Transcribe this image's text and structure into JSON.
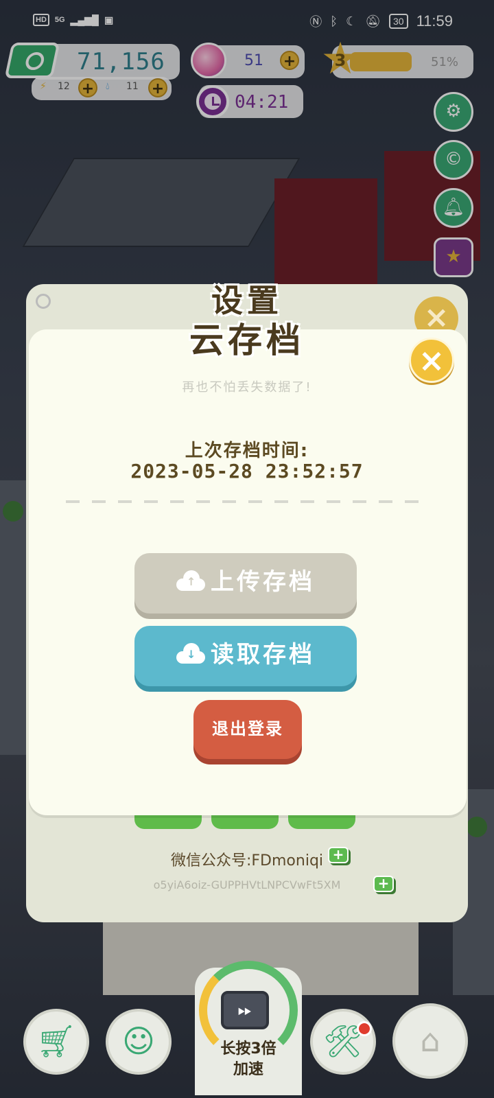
{
  "status_bar": {
    "network": "HD",
    "signal": "5G",
    "battery": "30",
    "time": "11:59"
  },
  "hud": {
    "money": "71,156",
    "energy": "12",
    "water": "11",
    "gems": "51",
    "level": "3",
    "level_progress": "51%",
    "timer": "04:21"
  },
  "back_panel": {
    "title": "设置",
    "wechat_label": "微信公众号:FDmoniqi",
    "openid": "o5yiA6oiz-GUPPHVtLNPCVwFt5XM"
  },
  "cloud_save": {
    "title": "云存档",
    "subtitle": "再也不怕丢失数据了!",
    "last_save_label": "上次存档时间:",
    "last_save_time": "2023-05-28  23:52:57",
    "upload_label": "上传存档",
    "download_label": "读取存档",
    "logout_label": "退出登录"
  },
  "bottom_bar": {
    "speed_label_line1": "长按3倍",
    "speed_label_line2": "加速"
  },
  "icons": {
    "close": "close-icon",
    "upload": "cloud-upload-icon",
    "download": "cloud-download-icon",
    "shop": "cart-icon",
    "emoji": "smile-icon",
    "tools": "tools-icon",
    "home": "home-icon"
  },
  "colors": {
    "accent_green": "#3aa874",
    "upload_button": "#cfccbe",
    "download_button": "#5cb9cd",
    "logout_button": "#d45d42",
    "close_button": "#f2c13a",
    "panel_bg": "#fbfcef"
  }
}
